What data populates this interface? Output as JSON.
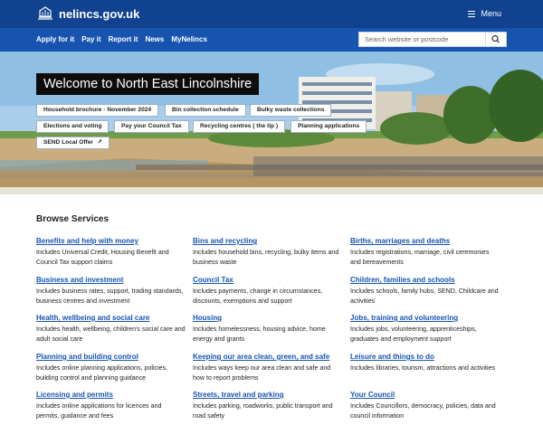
{
  "header": {
    "site_name": "nelincs.gov.uk",
    "menu_label": "Menu"
  },
  "nav": {
    "links": [
      "Apply for it",
      "Pay it",
      "Report it",
      "News",
      "MyNelincs"
    ],
    "search_placeholder": "Search website or postcode"
  },
  "hero": {
    "title": "Welcome to North East Lincolnshire",
    "quick_links": [
      "Household brochure - November 2024",
      "Bin collection schedule",
      "Bulky waste collections",
      "Elections and voting",
      "Pay your Council Tax",
      "Recycling centres ( the tip )",
      "Planning applications",
      "SEND Local Offer"
    ]
  },
  "browse": {
    "heading": "Browse Services",
    "services": [
      {
        "title": "Benefits and help with money",
        "desc": "Includes Universal Credit, Housing Benefit and Council Tax support claims"
      },
      {
        "title": "Bins and recycling",
        "desc": "Includes household bins, recycling, bulky items and business waste"
      },
      {
        "title": "Births, marriages and deaths",
        "desc": "Includes registrations, marriage, civil ceremonies and bereavements"
      },
      {
        "title": "Business and investment",
        "desc": "Includes business rates, support, trading standards, business centres and investment"
      },
      {
        "title": "Council Tax",
        "desc": "Includes payments, change in circumstances, discounts, exemptions and support"
      },
      {
        "title": "Children, families and schools",
        "desc": "Includes schools, family hubs, SEND, Childcare and activities"
      },
      {
        "title": "Health, wellbeing and social care",
        "desc": "Includes health, wellbeing, children's social care and adult social care"
      },
      {
        "title": "Housing",
        "desc": "Includes homelessness, housing advice, home energy and grants"
      },
      {
        "title": "Jobs, training and volunteering",
        "desc": "Includes jobs, volunteering, apprenticeships, graduates and employment support"
      },
      {
        "title": "Planning and building control",
        "desc": "Includes online planning applications, policies, building control and planning guidance"
      },
      {
        "title": "Keeping our area clean, green, and safe",
        "desc": "Includes ways keep our area clean and safe and how to report problems"
      },
      {
        "title": "Leisure and things to do",
        "desc": "Includes libraries, tourism, attractions and activities"
      },
      {
        "title": "Licensing and permits",
        "desc": "Includes online applications for licences and permits, guidance and fees"
      },
      {
        "title": "Streets, travel and parking",
        "desc": "Includes parking, roadworks, public transport and road safety"
      },
      {
        "title": "Your Council",
        "desc": "Includes Councillors, democracy, policies, data and council information"
      }
    ]
  }
}
